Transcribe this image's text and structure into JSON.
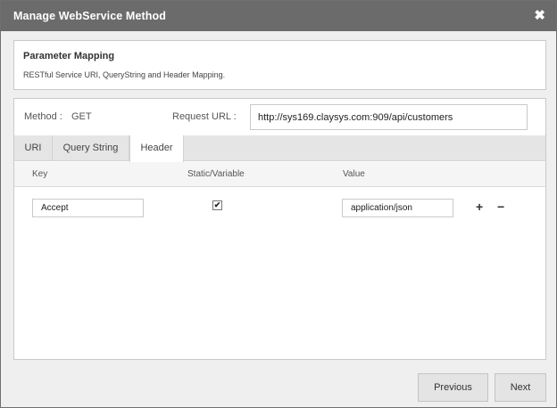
{
  "dialog": {
    "title": "Manage WebService Method",
    "close_glyph": "✖"
  },
  "info": {
    "heading": "Parameter Mapping",
    "description": "RESTful Service URI, QueryString and Header Mapping."
  },
  "method": {
    "label": "Method  :",
    "value": "GET"
  },
  "request_url": {
    "label": "Request URL  :",
    "value": "http://sys169.claysys.com:909/api/customers"
  },
  "tabs": [
    {
      "label": "URI",
      "active": false
    },
    {
      "label": "Query String",
      "active": false
    },
    {
      "label": "Header",
      "active": true
    }
  ],
  "columns": {
    "key": "Key",
    "static_variable": "Static/Variable",
    "value": "Value"
  },
  "rows": [
    {
      "key": "Accept",
      "static_checked": true,
      "value": "application/json",
      "check_glyph": "✔"
    }
  ],
  "row_actions": {
    "add_glyph": "+",
    "remove_glyph": "−"
  },
  "footer": {
    "previous_label": "Previous",
    "next_label": "Next"
  }
}
